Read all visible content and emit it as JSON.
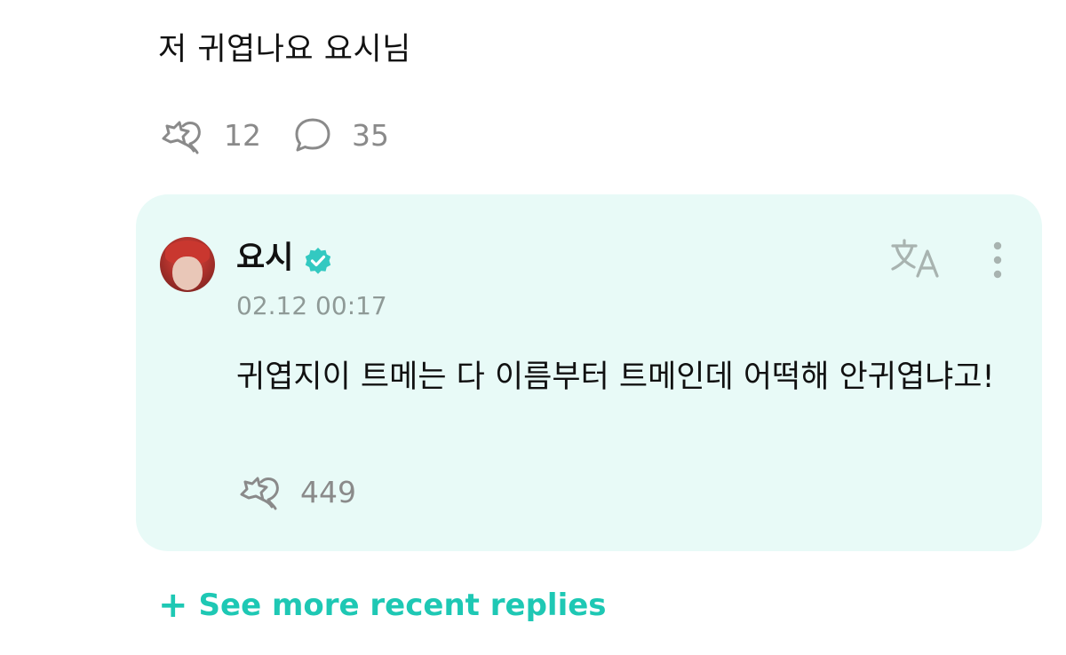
{
  "post": {
    "text": "저 귀엽나요 요시님",
    "like_count": "12",
    "comment_count": "35"
  },
  "reply": {
    "author": "요시",
    "timestamp": "02.12 00:17",
    "body": "귀엽지이 트메는 다 이름부터 트메인데 어떡해 안귀엽냐고!",
    "like_count": "449"
  },
  "see_more": {
    "plus": "+",
    "label": "See more recent replies"
  },
  "icons": {
    "like": "hug-star-icon",
    "comment": "speech-bubble-icon",
    "translate": "translate-icon",
    "more": "more-vertical-icon",
    "verified": "verified-badge-icon"
  },
  "colors": {
    "accent": "#1ec8b4",
    "card_background": "#e8faf7",
    "muted_text": "#8a8a8a",
    "verified": "#33c9c1"
  }
}
